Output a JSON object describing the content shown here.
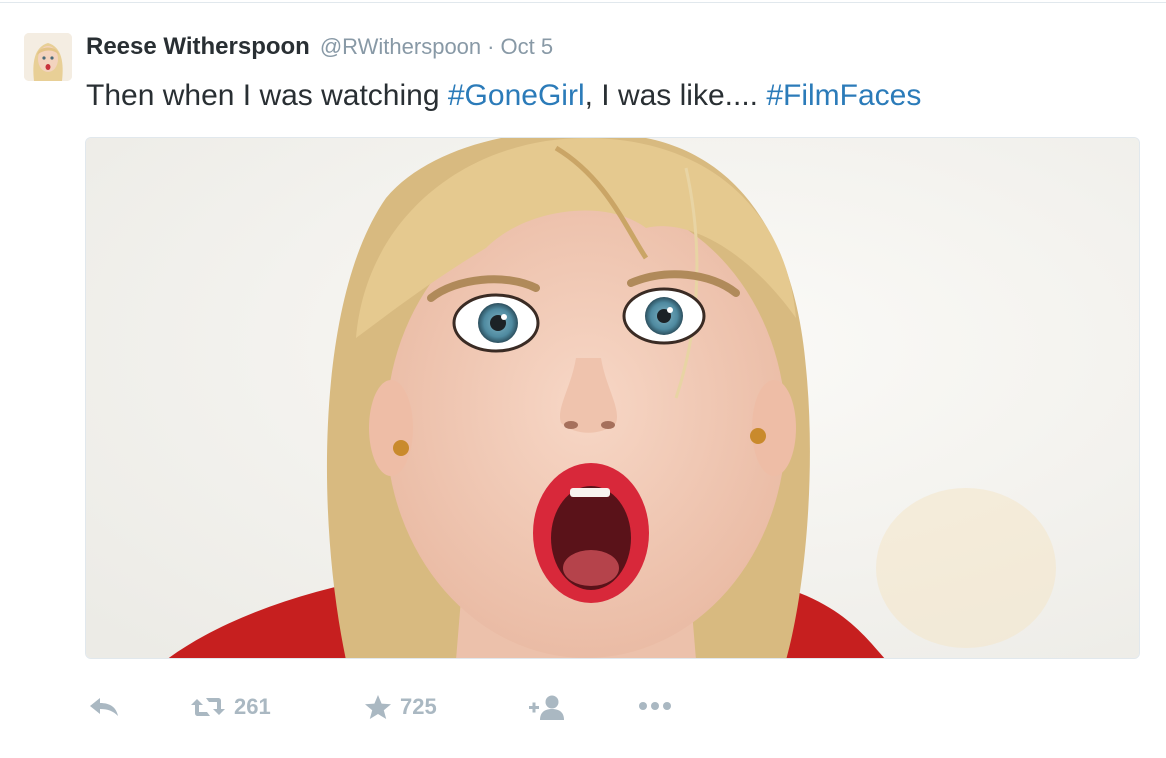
{
  "tweet": {
    "fullname": "Reese Witherspoon",
    "username": "@RWitherspoon",
    "separator": "·",
    "timestamp": "Oct 5",
    "text_before": "Then when I was watching ",
    "hashtag1": "#GoneGirl",
    "text_middle": ", I was like.... ",
    "hashtag2": "#FilmFaces"
  },
  "actions": {
    "retweet_count": "261",
    "favorite_count": "725"
  },
  "icons": {
    "reply": "reply-icon",
    "retweet": "retweet-icon",
    "favorite": "star-icon",
    "follow": "add-user-icon",
    "more": "more-icon"
  },
  "colors": {
    "text": "#292f33",
    "muted": "#8899a6",
    "hashtag": "#2b7bb9",
    "action_icon": "#aab8c2"
  }
}
